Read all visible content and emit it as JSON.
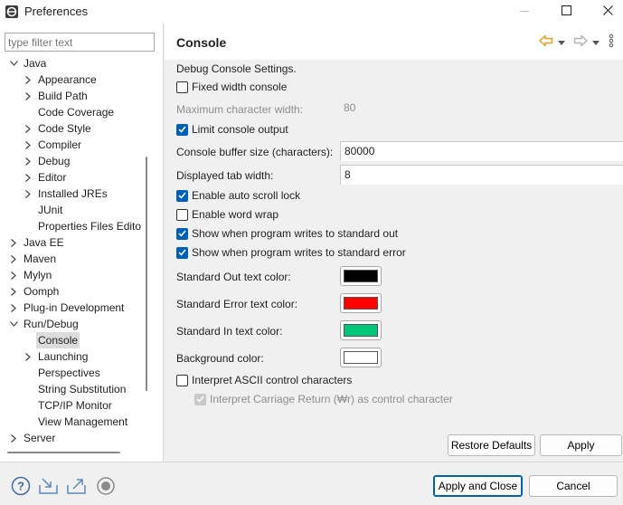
{
  "window": {
    "title": "Preferences",
    "minimize_icon": "minimize-icon",
    "maximize_icon": "maximize-icon",
    "close_icon": "close-icon"
  },
  "filter": {
    "placeholder": "type filter text",
    "value": ""
  },
  "tree": {
    "items": [
      {
        "label": "Java",
        "expanded": true
      },
      {
        "label": "Appearance"
      },
      {
        "label": "Build Path"
      },
      {
        "label": "Code Coverage"
      },
      {
        "label": "Code Style"
      },
      {
        "label": "Compiler"
      },
      {
        "label": "Debug"
      },
      {
        "label": "Editor"
      },
      {
        "label": "Installed JREs"
      },
      {
        "label": "JUnit"
      },
      {
        "label": "Properties Files Edito"
      },
      {
        "label": "Java EE"
      },
      {
        "label": "Maven"
      },
      {
        "label": "Mylyn"
      },
      {
        "label": "Oomph"
      },
      {
        "label": "Plug-in Development"
      },
      {
        "label": "Run/Debug",
        "expanded": true
      },
      {
        "label": "Console",
        "selected": true
      },
      {
        "label": "Launching"
      },
      {
        "label": "Perspectives"
      },
      {
        "label": "String Substitution"
      },
      {
        "label": "TCP/IP Monitor"
      },
      {
        "label": "View Management"
      },
      {
        "label": "Server"
      }
    ]
  },
  "page": {
    "title": "Console",
    "nav_icons": [
      "back-arrow-icon",
      "back-dropdown-icon",
      "forward-arrow-icon",
      "forward-dropdown-icon",
      "more-options-icon"
    ],
    "description": "Debug Console Settings.",
    "fixed_width_label": "Fixed width console",
    "fixed_width_checked": false,
    "max_char_width_label": "Maximum character width:",
    "max_char_width_value": "80",
    "limit_output_label": "Limit console output",
    "limit_output_checked": true,
    "buffer_size_label": "Console buffer size (characters):",
    "buffer_size_value": "80000",
    "tab_width_label": "Displayed tab width:",
    "tab_width_value": "8",
    "auto_scroll_label": "Enable auto scroll lock",
    "auto_scroll_checked": true,
    "word_wrap_label": "Enable word wrap",
    "word_wrap_checked": false,
    "show_stdout_label": "Show when program writes to standard out",
    "show_stdout_checked": true,
    "show_stderr_label": "Show when program writes to standard error",
    "show_stderr_checked": true,
    "stdout_color_label": "Standard Out text color:",
    "stdout_color": "#000000",
    "stderr_color_label": "Standard Error text color:",
    "stderr_color": "#ff0000",
    "stdin_color_label": "Standard In text color:",
    "stdin_color": "#00c878",
    "background_color_label": "Background color:",
    "background_color": "#ffffff",
    "ascii_label": "Interpret ASCII control characters",
    "ascii_checked": false,
    "carriage_return_label": "Interpret Carriage Return (₩r) as control character",
    "carriage_return_checked": true,
    "restore_defaults_label": "Restore Defaults",
    "apply_label": "Apply"
  },
  "footer": {
    "icons": [
      "help-icon",
      "import-icon",
      "export-icon",
      "record-icon"
    ],
    "apply_close_label": "Apply and Close",
    "cancel_label": "Cancel"
  },
  "colors": {
    "accent": "#005fb8",
    "nav_arrow": "#e8a020"
  }
}
